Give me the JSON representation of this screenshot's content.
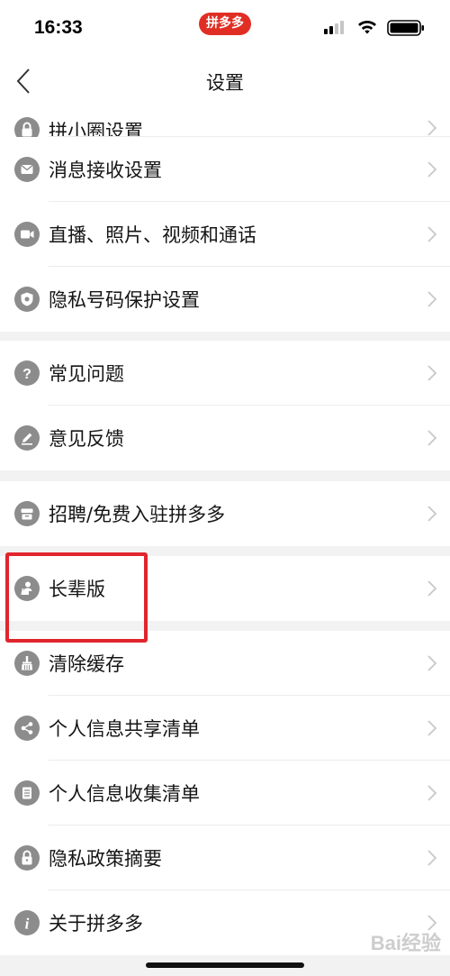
{
  "status_bar": {
    "time": "16:33",
    "app_badge": "拼多多"
  },
  "nav": {
    "title": "设置"
  },
  "groups": [
    [
      {
        "label": "拼小圈设置",
        "icon": "lock-icon"
      },
      {
        "label": "消息接收设置",
        "icon": "mail-icon"
      },
      {
        "label": "直播、照片、视频和通话",
        "icon": "video-camera-icon"
      },
      {
        "label": "隐私号码保护设置",
        "icon": "shield-phone-icon"
      }
    ],
    [
      {
        "label": "常见问题",
        "icon": "question-icon"
      },
      {
        "label": "意见反馈",
        "icon": "pencil-icon"
      }
    ],
    [
      {
        "label": "招聘/免费入驻拼多多",
        "icon": "store-icon"
      }
    ],
    [
      {
        "label": "长辈版",
        "icon": "elder-icon"
      }
    ],
    [
      {
        "label": "清除缓存",
        "icon": "broom-icon"
      },
      {
        "label": "个人信息共享清单",
        "icon": "share-icon"
      },
      {
        "label": "个人信息收集清单",
        "icon": "list-icon"
      },
      {
        "label": "隐私政策摘要",
        "icon": "lock-icon"
      },
      {
        "label": "关于拼多多",
        "icon": "info-icon"
      }
    ]
  ],
  "watermark": "Bai经验",
  "colors": {
    "brand_red": "#e02e24",
    "highlight_red": "#e0252d",
    "icon_gray": "#8c8c8c"
  }
}
